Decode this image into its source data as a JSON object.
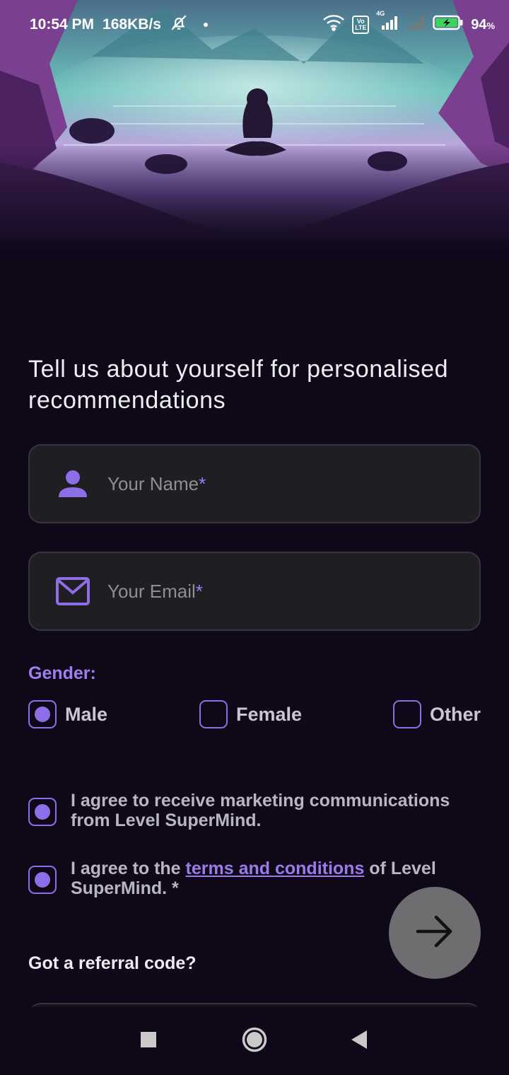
{
  "status_bar": {
    "time": "10:54 PM",
    "speed": "168KB/s",
    "battery": "94",
    "battery_unit": "%",
    "network_label": "4G",
    "volte_label": "Vo LTE"
  },
  "hero": {
    "image": "meditating-woman-lake-illustration",
    "colors": {
      "teal": "#5fb9b3",
      "purple": "#8a5fc0",
      "dark": "#0e0819"
    }
  },
  "form": {
    "heading": "Tell us about yourself for personalised recommendations",
    "name_field": {
      "placeholder": "Your Name",
      "required_mark": "*",
      "value": ""
    },
    "email_field": {
      "placeholder": "Your Email",
      "required_mark": "*",
      "value": ""
    },
    "gender": {
      "label": "Gender:",
      "options": [
        {
          "label": "Male",
          "selected": true
        },
        {
          "label": "Female",
          "selected": false
        },
        {
          "label": "Other",
          "selected": false
        }
      ]
    },
    "consents": {
      "marketing": "I agree to receive marketing communications from Level SuperMind.",
      "terms_prefix": "I agree to the ",
      "terms_link": "terms and conditions",
      "terms_suffix": " of Level SuperMind. *"
    },
    "referral_label": "Got a referral code?"
  },
  "fab": {
    "icon": "arrow-right-icon"
  },
  "nav": {
    "items": [
      "recent-apps-icon",
      "home-icon",
      "back-icon"
    ]
  },
  "colors": {
    "background": "#0e0819",
    "field_bg": "#1f1e23",
    "accent": "#8e6ee6",
    "fab_bg": "#6e6e70"
  }
}
